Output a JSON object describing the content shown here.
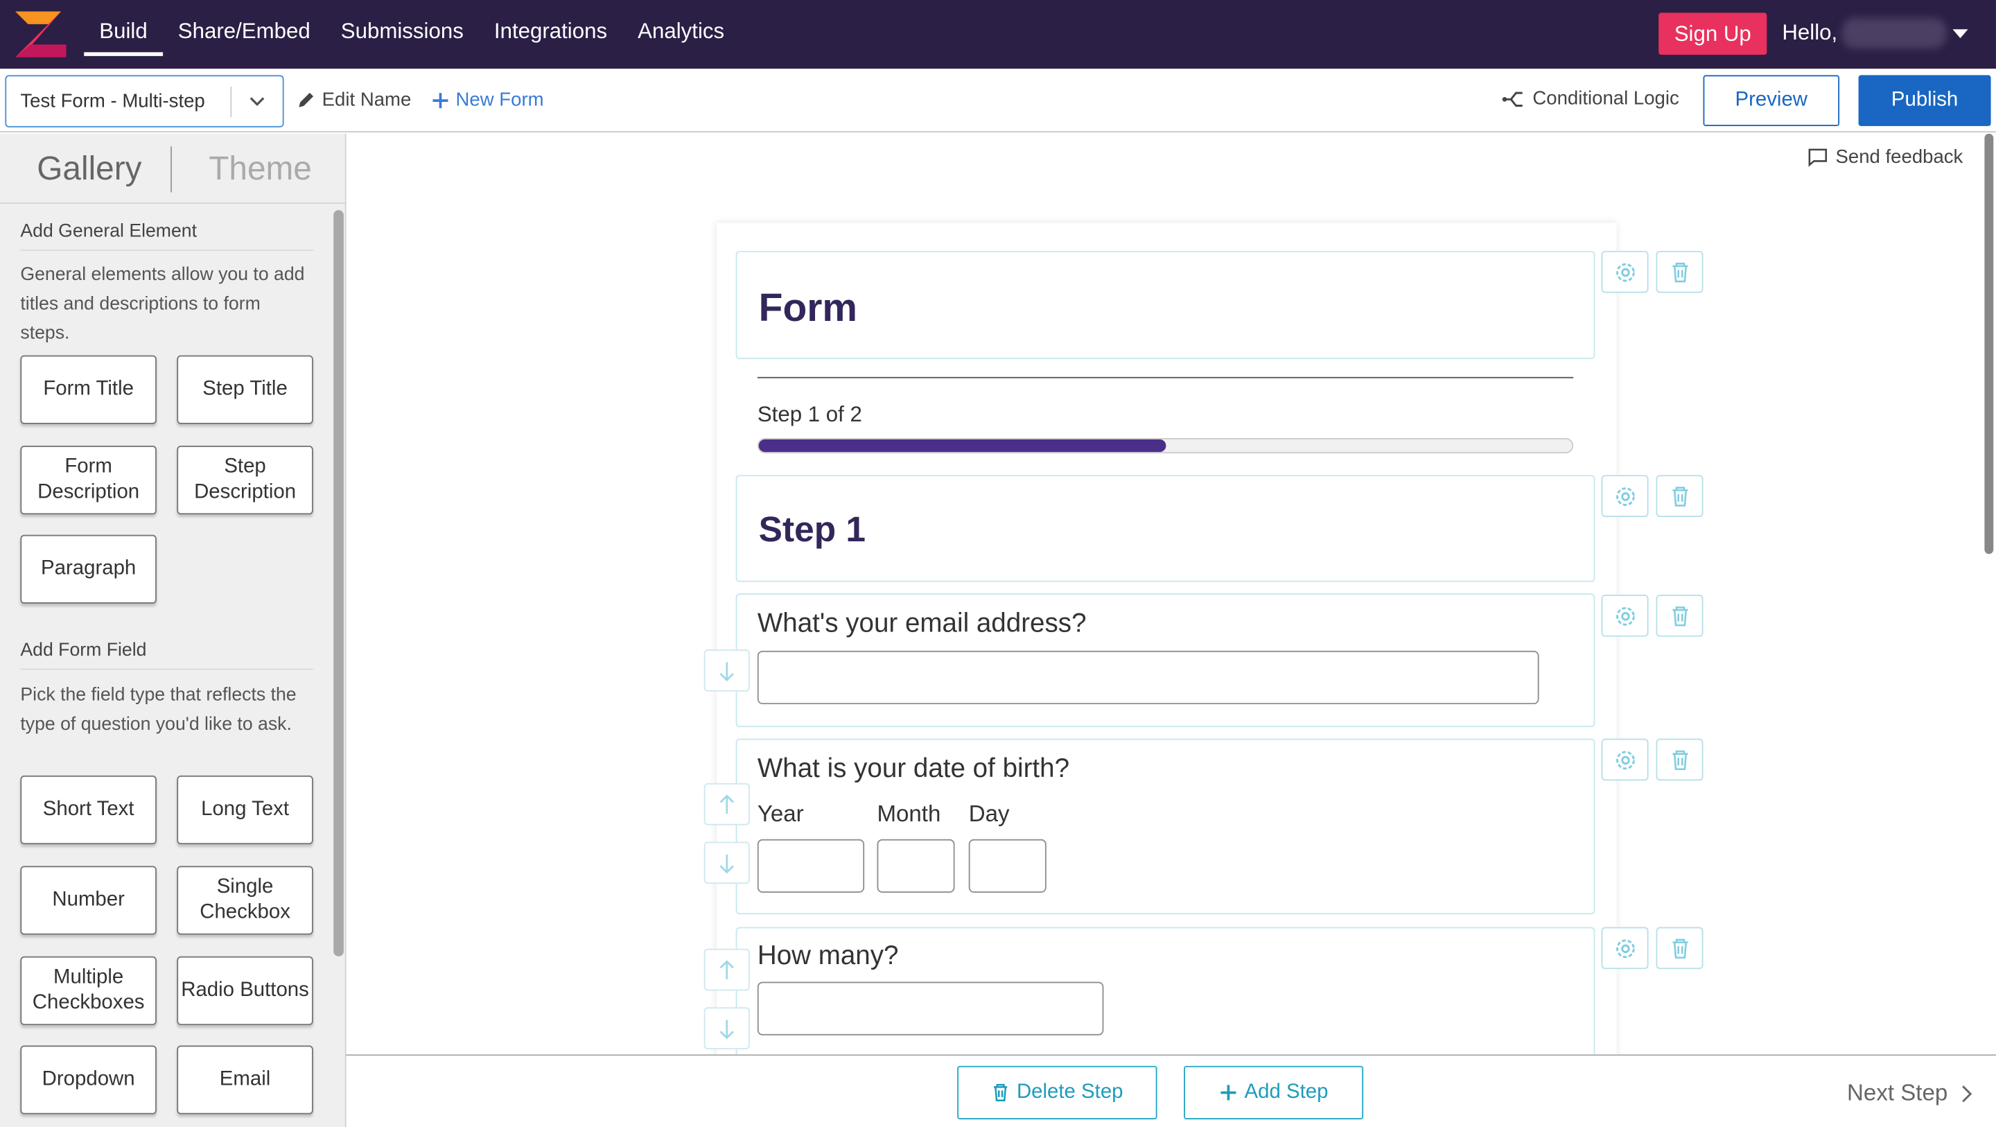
{
  "topnav": {
    "links": [
      "Build",
      "Share/Embed",
      "Submissions",
      "Integrations",
      "Analytics"
    ],
    "active": "Build",
    "signup_label": "Sign Up",
    "hello_label": "Hello,",
    "colors": {
      "bar": "#2b1f45",
      "signup": "#e8315e"
    }
  },
  "toolbar": {
    "form_name": "Test Form - Multi-step",
    "edit_name_label": "Edit Name",
    "new_form_label": "New Form",
    "conditional_logic_label": "Conditional Logic",
    "preview_label": "Preview",
    "publish_label": "Publish"
  },
  "sidebar": {
    "tabs": [
      "Gallery",
      "Theme"
    ],
    "general": {
      "title": "Add General Element",
      "description": "General elements allow you to add titles and descriptions to form steps.",
      "buttons": [
        "Form Title",
        "Step Title",
        "Form Description",
        "Step Description",
        "Paragraph"
      ]
    },
    "fields": {
      "title": "Add Form Field",
      "description": "Pick the field type that reflects the type of question you'd like to ask.",
      "buttons": [
        "Short Text",
        "Long Text",
        "Number",
        "Single Checkbox",
        "Multiple Checkboxes",
        "Radio Buttons",
        "Dropdown",
        "Email"
      ]
    }
  },
  "main": {
    "send_feedback_label": "Send feedback",
    "form_title": "Form",
    "progress": {
      "label": "Step 1 of 2",
      "current": 1,
      "total": 2,
      "fraction": 0.5
    },
    "step_title": "Step 1",
    "questions": [
      {
        "label": "What's your email address?"
      },
      {
        "label": "What is your date of birth?",
        "sub_labels": [
          "Year",
          "Month",
          "Day"
        ]
      },
      {
        "label": "How many?"
      }
    ]
  },
  "bottombar": {
    "delete_step_label": "Delete Step",
    "add_step_label": "Add Step",
    "next_step_label": "Next Step"
  },
  "icons": [
    "logo-icon",
    "chevron-down-icon",
    "pencil-icon",
    "plus-icon",
    "branch-icon",
    "comment-icon",
    "gear-icon",
    "trash-icon",
    "arrow-up-icon",
    "arrow-down-icon",
    "chevron-right-icon",
    "caret-down-icon"
  ]
}
